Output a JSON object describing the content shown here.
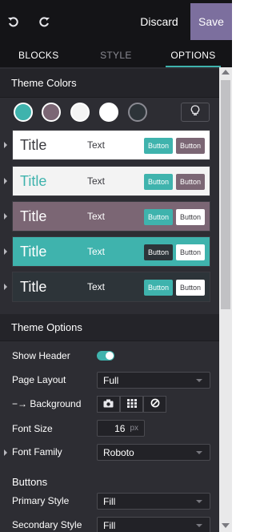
{
  "toolbar": {
    "undo_icon": "undo-icon",
    "redo_icon": "redo-icon",
    "discard_label": "Discard",
    "save_label": "Save",
    "save_color": "#7c6f9e"
  },
  "tabs": [
    {
      "label": "BLOCKS",
      "state": "normal"
    },
    {
      "label": "STYLE",
      "state": "muted"
    },
    {
      "label": "OPTIONS",
      "state": "active"
    }
  ],
  "theme_colors": {
    "heading": "Theme Colors",
    "swatches": [
      "#3fb3ad",
      "#7b6674",
      "#f4f4f4",
      "#ffffff",
      "#2d3439"
    ],
    "bulb_icon": "lightbulb-icon"
  },
  "presets": [
    {
      "title": "Title",
      "text": "Text",
      "button1": "Button",
      "button2": "Button"
    },
    {
      "title": "Title",
      "text": "Text",
      "button1": "Button",
      "button2": "Button"
    },
    {
      "title": "Title",
      "text": "Text",
      "button1": "Button",
      "button2": "Button"
    },
    {
      "title": "Title",
      "text": "Text",
      "button1": "Button",
      "button2": "Button"
    },
    {
      "title": "Title",
      "text": "Text",
      "button1": "Button",
      "button2": "Button"
    }
  ],
  "theme_options": {
    "heading": "Theme Options",
    "show_header": {
      "label": "Show Header",
      "enabled": true
    },
    "page_layout": {
      "label": "Page Layout",
      "value": "Full"
    },
    "background": {
      "label": "Background",
      "prefix": "−→",
      "icons": [
        "camera-icon",
        "pattern-grid-icon",
        "no-image-icon"
      ]
    },
    "font_size": {
      "label": "Font Size",
      "value": "16",
      "unit": "px"
    },
    "font_family": {
      "label": "Font Family",
      "value": "Roboto"
    },
    "buttons_heading": "Buttons",
    "primary_style": {
      "label": "Primary Style",
      "value": "Fill"
    },
    "secondary_style": {
      "label": "Secondary Style",
      "value": "Fill"
    }
  }
}
